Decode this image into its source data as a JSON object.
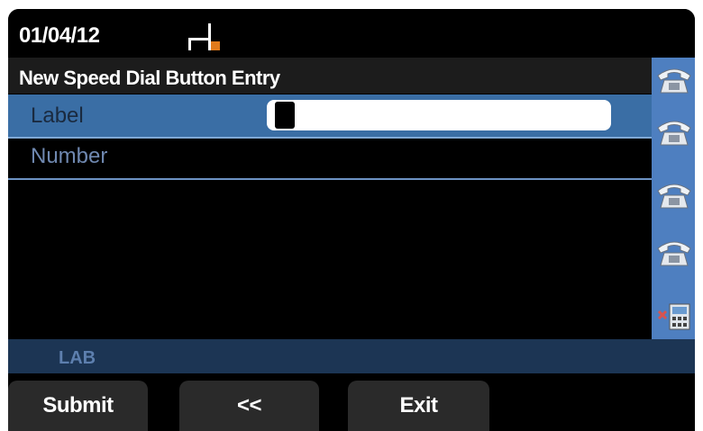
{
  "status": {
    "date": "01/04/12"
  },
  "header": {
    "title": "New Speed Dial Button Entry"
  },
  "fields": [
    {
      "label": "Label",
      "value": ""
    },
    {
      "label": "Number"
    }
  ],
  "line_keys": [
    "phone-icon",
    "phone-icon",
    "phone-icon",
    "phone-icon",
    "directory-remove-icon"
  ],
  "bottom_bar": {
    "label": "LAB"
  },
  "softkeys": [
    "Submit",
    "<<",
    "Exit"
  ],
  "colors": {
    "screen": "#000000",
    "title_bar": "#1c1c1c",
    "selected_row": "#3a6ea5",
    "line_key_column": "#4e7fc0",
    "bottom_bar": "#1c3554",
    "softkey": "#2a2a2a",
    "signal_orange": "#e07a1c"
  }
}
